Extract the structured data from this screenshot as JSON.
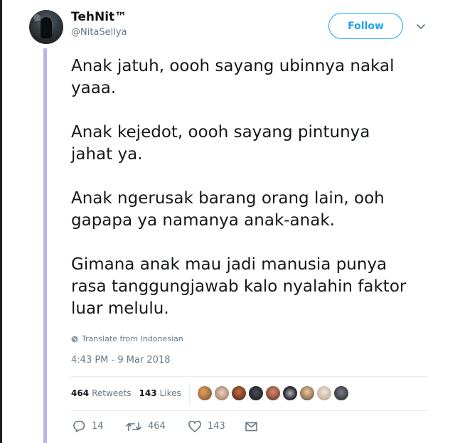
{
  "user": {
    "display_name": "TehNit™",
    "screen_name": "@NitaSellya"
  },
  "follow_label": "Follow",
  "tweet": {
    "paragraphs": [
      "Anak jatuh, oooh sayang ubinnya nakal\nyaaa.",
      "Anak kejedot, oooh sayang pintunya\njahat ya.",
      "Anak ngerusak barang orang lain, ooh\ngapapa ya namanya anak-anak.",
      "Gimana anak mau jadi manusia punya\nrasa tanggungjawab kalo nyalahin faktor\nluar melulu."
    ],
    "translate_label": "Translate from Indonesian",
    "timestamp": "4:43 PM - 9 Mar 2018"
  },
  "stats": {
    "retweets_count": "464",
    "retweets_label": "Retweets",
    "likes_count": "143",
    "likes_label": "Likes"
  },
  "likers_avatars": [
    "avatar-1",
    "avatar-2",
    "avatar-3",
    "avatar-4",
    "avatar-5",
    "avatar-6",
    "avatar-7",
    "avatar-8",
    "avatar-9"
  ],
  "actions": {
    "reply_count": "14",
    "retweet_count": "464",
    "like_count": "143"
  },
  "colors": {
    "accent": "#1da1f2",
    "thread_bar": "#b9b4ec",
    "secondary_text": "#657786"
  }
}
